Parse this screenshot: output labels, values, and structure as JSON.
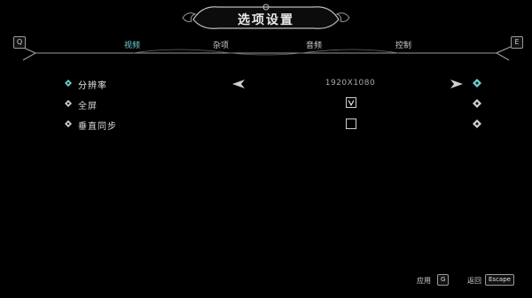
{
  "header": {
    "title": "选项设置",
    "left_key": "Q",
    "right_key": "E"
  },
  "tabs": [
    {
      "label": "视频",
      "active": true
    },
    {
      "label": "杂项",
      "active": false
    },
    {
      "label": "音频",
      "active": false
    },
    {
      "label": "控制",
      "active": false
    }
  ],
  "settings": {
    "resolution": {
      "label": "分辨率",
      "value": "1920X1080"
    },
    "fullscreen": {
      "label": "全屏",
      "checked": true
    },
    "vsync": {
      "label": "垂直同步",
      "checked": false
    }
  },
  "footer": {
    "apply_label": "应用",
    "apply_key": "G",
    "back_label": "返回",
    "back_key": "Escape"
  },
  "colors": {
    "accent": "#6fd0d0",
    "background": "#000000",
    "text": "#d8d8d8"
  }
}
